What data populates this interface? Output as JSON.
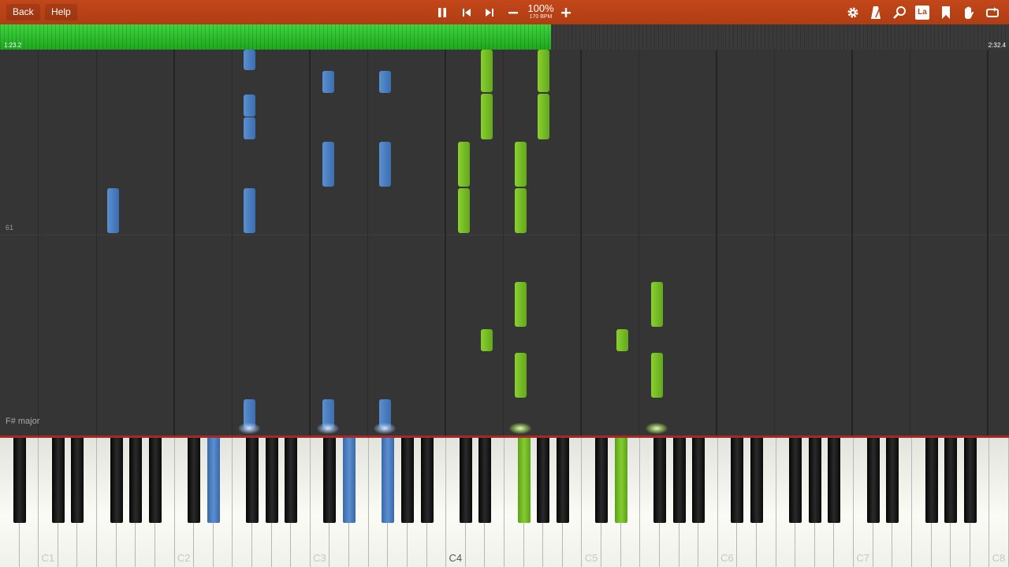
{
  "toolbar": {
    "back_label": "Back",
    "help_label": "Help",
    "speed_percent": "100%",
    "tempo": "170 BPM",
    "icons": [
      "pause-icon",
      "skip-previous-icon",
      "skip-next-icon",
      "minus-icon",
      "plus-icon",
      "settings-icon",
      "metronome-icon",
      "search-icon",
      "label-icon",
      "bookmark-icon",
      "hand-icon",
      "loop-icon"
    ],
    "label_icon_text": "La"
  },
  "progress": {
    "elapsed": "1:23.2",
    "total": "2:32.4",
    "fraction": 0.546,
    "color": "#2ec22e"
  },
  "roll": {
    "row_label": "61",
    "key_signature": "F# major"
  },
  "colors": {
    "left_hand": "#4a7fc4",
    "right_hand": "#74bc24",
    "background": "#353535",
    "toolbar": "#b8431a"
  },
  "keyboard": {
    "octave_labels": [
      "C1",
      "C2",
      "C3",
      "C4",
      "C5",
      "C6",
      "C7",
      "C8"
    ],
    "pressed_blue": [
      "D#2",
      "D#3",
      "F#3"
    ],
    "pressed_green": [
      "F#4",
      "D#5"
    ]
  }
}
